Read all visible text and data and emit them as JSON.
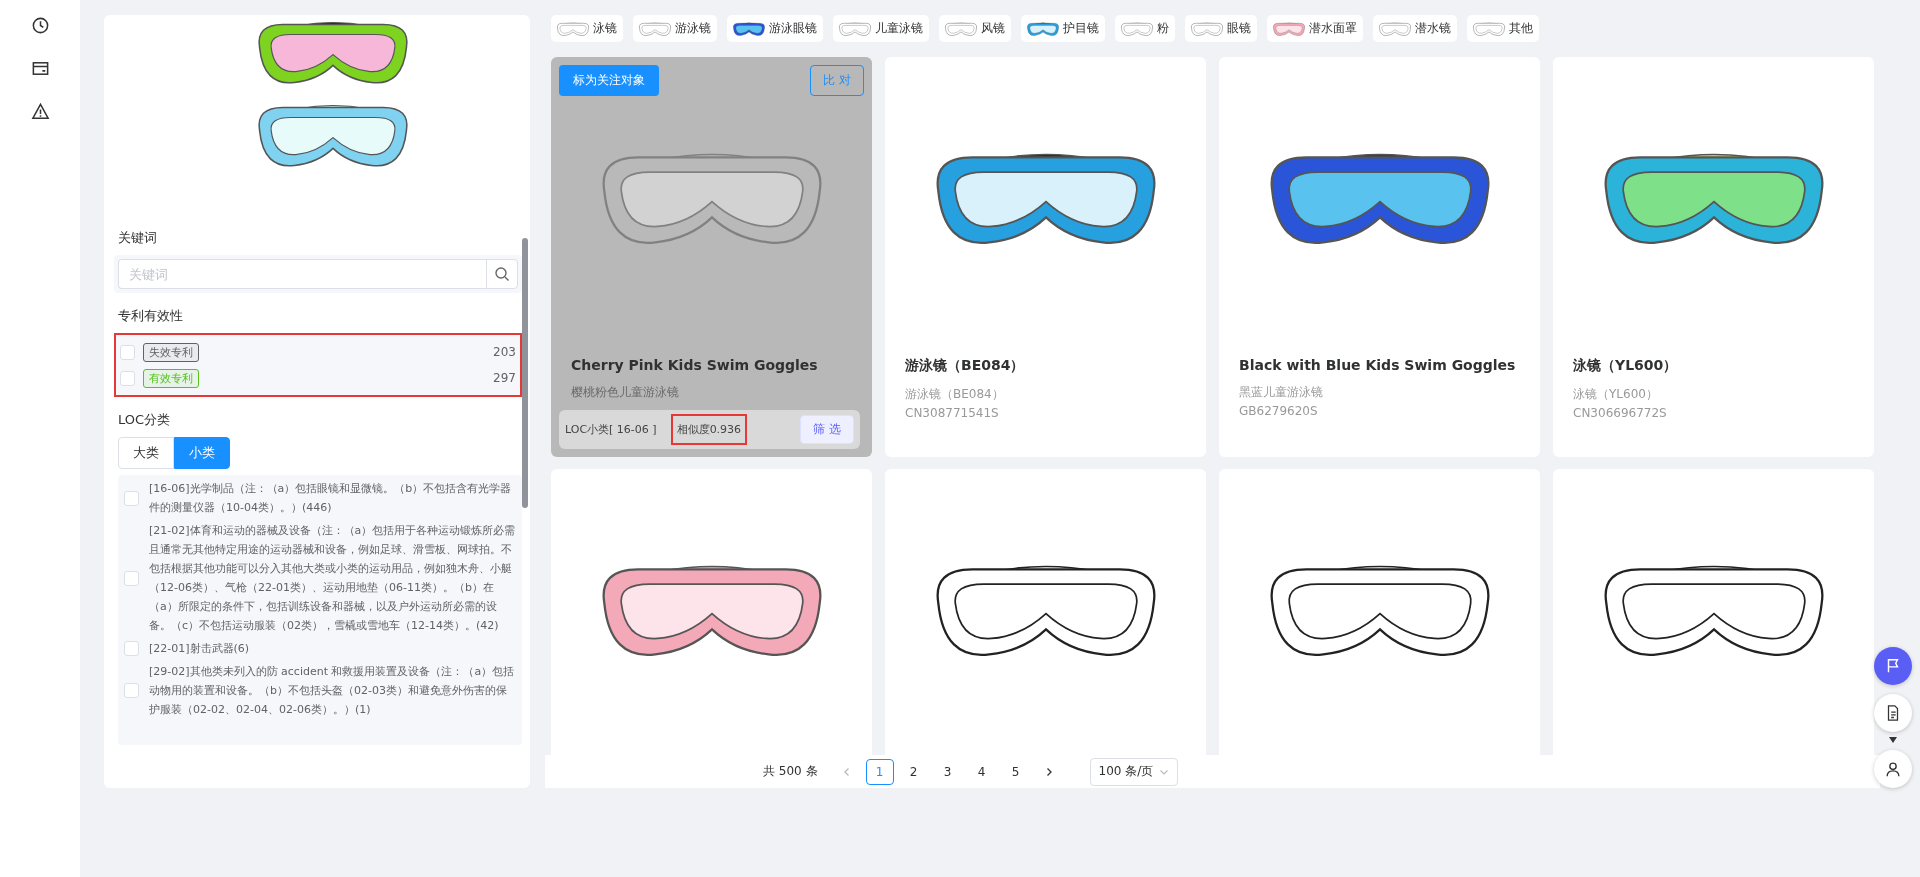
{
  "query_panel": {
    "keyword": {
      "label": "关键词",
      "placeholder": "关键词"
    },
    "validity": {
      "label": "专利有效性",
      "highlighted": true,
      "items": [
        {
          "tag": "失效专利",
          "count": "203",
          "checked": false,
          "color": "#606266"
        },
        {
          "tag": "有效专利",
          "count": "297",
          "checked": false,
          "color": "#52c41a"
        }
      ]
    },
    "loc": {
      "label": "LOC分类",
      "levels": [
        {
          "label": "大类",
          "selected": false
        },
        {
          "label": "小类",
          "selected": true
        }
      ],
      "items": [
        {
          "text": "[16-06]光学制品（注：（a）包括眼镜和显微镜。（b）不包括含有光学器件的测量仪器（10-04类）。）(446)",
          "checked": false
        },
        {
          "text": "[21-02]体育和运动的器械及设备（注：（a）包括用于各种运动锻炼所必需且通常无其他特定用途的运动器械和设备，例如足球、滑雪板、网球拍。不包括根据其他功能可以分入其他大类或小类的运动用品，例如独木舟、小艇（12-06类）、气枪（22-01类）、运动用地垫（06-11类）。（b）在（a）所限定的条件下，包括训练设备和器械，以及户外运动所必需的设备。（c）不包括运动服装（02类），雪橇或雪地车（12-14类）。(42)",
          "checked": false
        },
        {
          "text": "[22-01]射击武器(6)",
          "checked": false
        },
        {
          "text": "[29-02]其他类未列入的防 accident 和救援用装置及设备（注：（a）包括动物用的装置和设备。（b）不包括头盔（02-03类）和避免意外伤害的保护服装（02-02、02-04、02-06类）。）(1)",
          "checked": false
        }
      ]
    }
  },
  "categories": [
    {
      "label": "泳镜"
    },
    {
      "label": "游泳镜"
    },
    {
      "label": "游泳眼镜"
    },
    {
      "label": "儿童泳镜"
    },
    {
      "label": "风镜"
    },
    {
      "label": "护目镜"
    },
    {
      "label": "粉"
    },
    {
      "label": "眼镜"
    },
    {
      "label": "潜水面罩"
    },
    {
      "label": "潜水镜"
    },
    {
      "label": "其他"
    }
  ],
  "cards": [
    {
      "hovered": true,
      "title": "Cherry Pink Kids Swim Goggles",
      "subtitle": "樱桃粉色儿童游泳镜",
      "overlay": {
        "follow": "标为关注对象",
        "compare": "比 对",
        "loc": "LOC小类[ 16-06 ]",
        "similarity": "相似度0.936",
        "similarity_highlighted": true,
        "filter": "筛 选"
      }
    },
    {
      "hovered": false,
      "title": "游泳镜（BE084）",
      "subtitle": "游泳镜（BE084）",
      "number": "CN308771541S"
    },
    {
      "hovered": false,
      "title": "Black with Blue Kids Swim Goggles",
      "subtitle": "黑蓝儿童游泳镜",
      "number": "GB6279620S"
    },
    {
      "hovered": false,
      "title": "泳镜（YL600）",
      "subtitle": "泳镜（YL600）",
      "number": "CN306696772S"
    },
    {
      "hovered": false
    },
    {
      "hovered": false
    },
    {
      "hovered": false
    },
    {
      "hovered": false
    }
  ],
  "pagination": {
    "total": "共 500 条",
    "pages": [
      {
        "label": "1",
        "selected": true
      },
      {
        "label": "2",
        "selected": false
      },
      {
        "label": "3",
        "selected": false
      },
      {
        "label": "4",
        "selected": false
      },
      {
        "label": "5",
        "selected": false
      }
    ],
    "page_size": "100 条/页"
  }
}
